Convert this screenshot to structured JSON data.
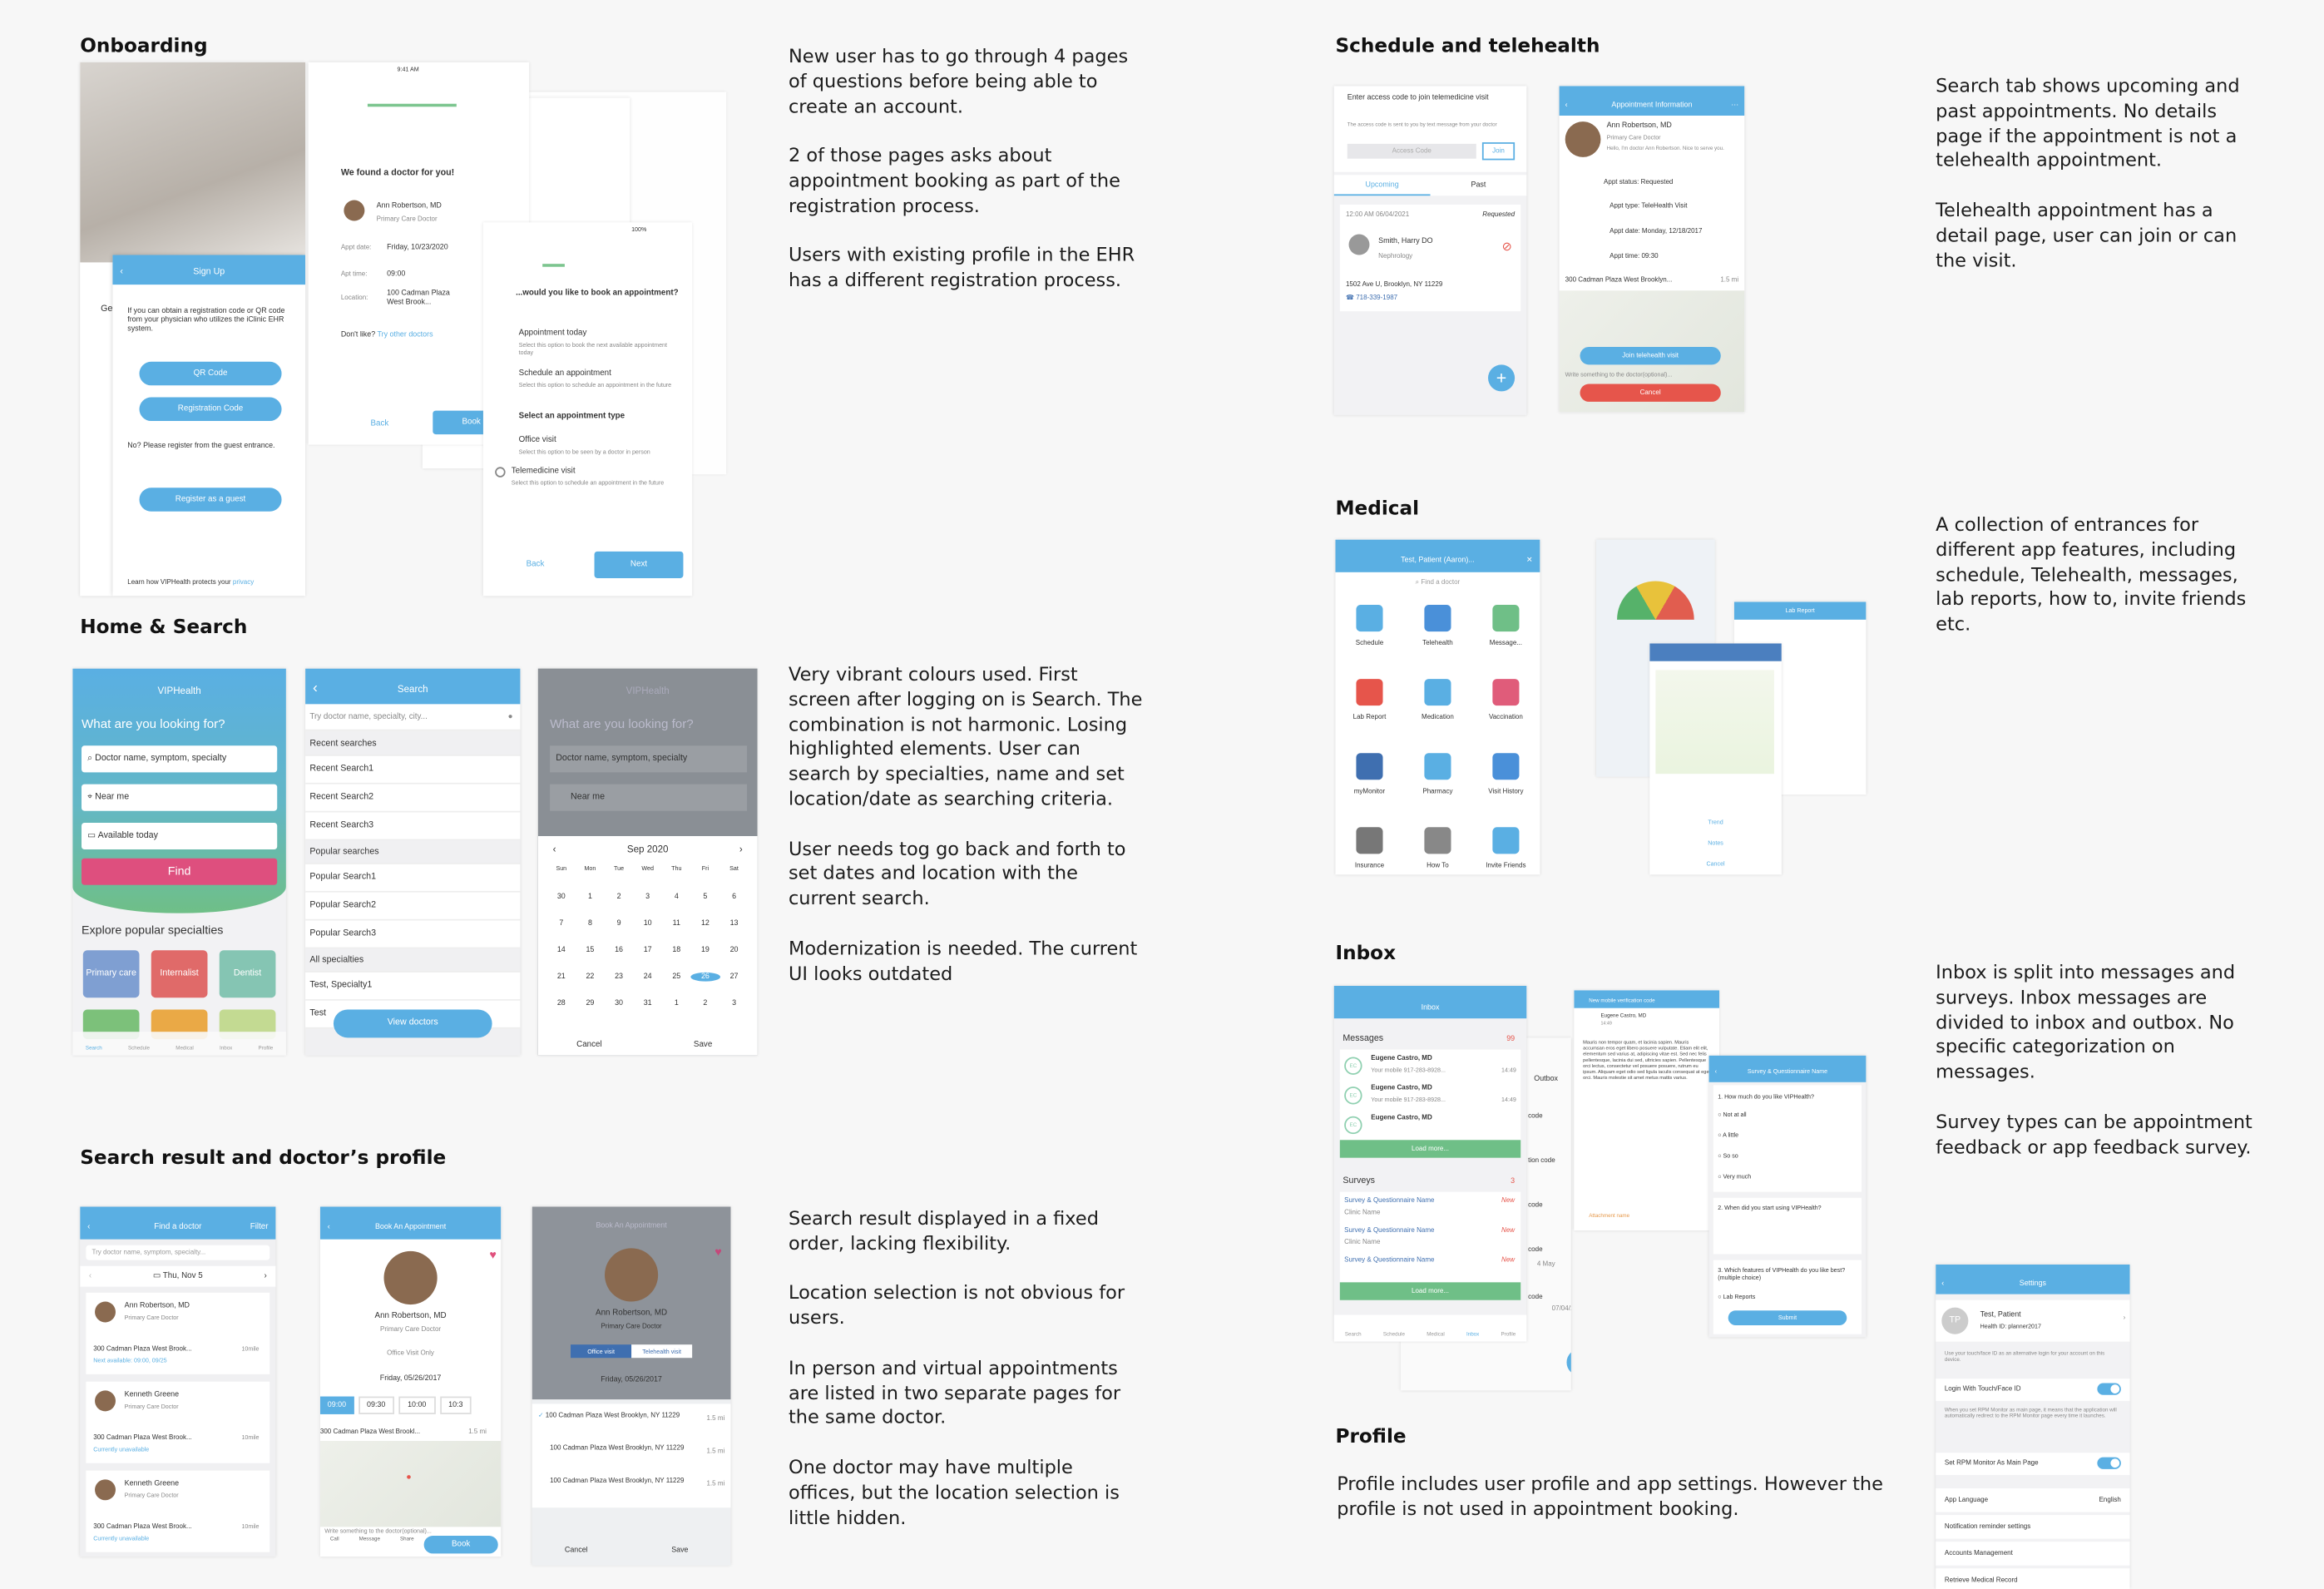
{
  "sections": {
    "onboarding": "Onboarding",
    "home": "Home & Search",
    "results": "Search result and doctor’s profile",
    "schedule": "Schedule and telehealth",
    "medical": "Medical",
    "inbox": "Inbox",
    "profile": "Profile"
  },
  "notes": {
    "onboarding": [
      "New user has to go through 4 pages of questions before being able to create an account.",
      "2 of those pages asks about appointment booking as part of the registration process.",
      "Users with existing profile in the EHR has a different registration process."
    ],
    "home": [
      "Very vibrant colours used. First screen after logging on is Search. The combination is not harmonic. Losing highlighted elements. User can search by specialties, name and set location/date as searching criteria.",
      "User needs tog go back and forth to set dates and location with the current search.",
      "Modernization is needed. The current UI looks outdated"
    ],
    "results": [
      "Search result displayed in a fixed order, lacking flexibility.",
      "Location selection is not obvious for users.",
      "In person and virtual appointments are listed in two separate pages for the same doctor.",
      "One doctor may have multiple offices, but the location selection is little hidden."
    ],
    "schedule": [
      "Search tab shows upcoming and past appointments. No details page if the appointment is not a telehealth appointment.",
      "Telehealth appointment has a detail page, user can join or can the visit."
    ],
    "medical": [
      "A collection of entrances for different app features, including schedule, Telehealth, messages, lab reports, how to, invite friends etc."
    ],
    "inbox": [
      "Inbox is split into messages and surveys. Inbox messages are divided to inbox and outbox. No specific categorization on messages.",
      "Survey types can be appointment feedback or app feedback survey."
    ],
    "profile": [
      "Profile includes user profile and app settings. However the profile is not used in appointment booking."
    ]
  },
  "colors": {
    "primary": "#5aafe3",
    "find": "#de4f7e",
    "green": "#6fbf87"
  },
  "status": {
    "time": "9:41 AM",
    "battery": "100%"
  },
  "signup": {
    "title": "Sign Up",
    "behind": "Ge",
    "text": "If you can obtain a registration code or QR code from your physician who utilizes the iClinic EHR system.",
    "qr": "QR Code",
    "reg": "Registration Code",
    "guest_text": "No? Please register from the guest entrance.",
    "guest": "Register as a guest",
    "footer": "Learn how VIPHealth protects your",
    "privacy": "privacy"
  },
  "found": {
    "title": "We found a doctor for you!",
    "doctor": "Ann Robertson, MD",
    "role": "Primary Care Doctor",
    "date_label": "Appt date:",
    "date": "Friday, 10/23/2020",
    "time_label": "Apt time:",
    "time": "09:00",
    "loc_label": "Location:",
    "loc": "100 Cadman Plaza West Brook...",
    "dislike": "Don't like?",
    "other": "Try other doctors",
    "back": "Back",
    "book": "Book"
  },
  "apptype": {
    "q": "...would you like to book an appointment?",
    "o1": "Appointment today",
    "o1d": "Select this option to book the next available appointment today",
    "o2": "Schedule an appointment",
    "o2d": "Select this option to schedule an appointment in the future",
    "title": "Select an appointment type",
    "o3": "Office visit",
    "o3d": "Select this option to be seen by a doctor in person",
    "o4": "Telemedicine visit",
    "o4d": "Select this option to schedule an appointment in the future",
    "back": "Back",
    "next": "Next"
  },
  "home": {
    "app": "VIPHealth",
    "q": "What are you looking for?",
    "f1": "Doctor name, symptom, specialty",
    "f2": "Near me",
    "f3": "Available today",
    "find": "Find",
    "explore": "Explore popular specialties",
    "tiles": [
      "Primary care",
      "Internalist",
      "Dentist"
    ],
    "tabs": [
      "Search",
      "Schedule",
      "Medical",
      "Inbox",
      "Profile"
    ]
  },
  "search": {
    "title": "Search",
    "placeholder": "Try doctor name, specialty, city...",
    "recent": "Recent searches",
    "recent_items": [
      "Recent Search1",
      "Recent Search2",
      "Recent Search3"
    ],
    "popular": "Popular searches",
    "popular_items": [
      "Popular Search1",
      "Popular Search2",
      "Popular Search3"
    ],
    "all": "All specialties",
    "spec": [
      "Test, Specialty1",
      "Test"
    ],
    "view": "View doctors"
  },
  "calendar": {
    "month": "Sep 2020",
    "days": [
      "Sun",
      "Mon",
      "Tue",
      "Wed",
      "Thu",
      "Fri",
      "Sat"
    ],
    "dates": [
      "30",
      "1",
      "2",
      "3",
      "4",
      "5",
      "6",
      "7",
      "8",
      "9",
      "10",
      "11",
      "12",
      "13",
      "14",
      "15",
      "16",
      "17",
      "18",
      "19",
      "20",
      "21",
      "22",
      "23",
      "24",
      "25",
      "26",
      "27",
      "28",
      "29",
      "30",
      "31",
      "1",
      "2",
      "3"
    ],
    "selected": "26",
    "cancel": "Cancel",
    "save": "Save"
  },
  "results": {
    "title": "Find a doctor",
    "filter": "Filter",
    "placeholder": "Try doctor name, symptom, specialty...",
    "date": "Thu, Nov 5",
    "cards": [
      {
        "name": "Ann Robertson, MD",
        "role": "Primary Care Doctor",
        "addr": "300 Cadman Plaza West Brook...",
        "dist": "10mile",
        "avail": "Next available: 09:00, 09/25"
      },
      {
        "name": "Kenneth Greene",
        "role": "Primary Care Doctor",
        "addr": "300 Cadman Plaza West Brook...",
        "dist": "10mile",
        "avail": "Currently unavailable"
      },
      {
        "name": "Kenneth Greene",
        "role": "Primary Care Doctor",
        "addr": "300 Cadman Plaza West Brook...",
        "dist": "10mile",
        "avail": "Currently unavailable"
      }
    ]
  },
  "book": {
    "title": "Book An Appointment",
    "doctor": "Ann Robertson, MD",
    "role": "Primary Care Doctor",
    "only": "Office Visit Only",
    "date": "Friday, 05/26/2017",
    "times": [
      "09:00",
      "09:30",
      "10:00",
      "10:3"
    ],
    "addr": "300 Cadman Plaza West Brookl...",
    "dist": "1.5 mi",
    "write": "Write something to the doctor(optional)...",
    "actions": [
      "Call",
      "Message",
      "Share"
    ],
    "book": "Book"
  },
  "book2": {
    "title": "Book An Appointment",
    "tab1": "Office visit",
    "tab2": "Telehealth visit",
    "addrs": [
      "100 Cadman Plaza West Brooklyn, NY 11229",
      "100 Cadman Plaza West Brooklyn, NY 11229",
      "100 Cadman Plaza West Brooklyn, NY 11229"
    ],
    "dist": "1.5 mi",
    "cancel": "Cancel",
    "save": "Save"
  },
  "sched": {
    "enter": "Enter access code to join telemedicine visit",
    "hint": "The access code is sent to you by text message from your doctor",
    "code": "Access Code",
    "join": "Join",
    "tabs": [
      "Upcoming",
      "Past"
    ],
    "when": "12:00 AM 06/04/2021",
    "status": "Requested",
    "doctor": "Smith, Harry DO",
    "spec": "Nephrology",
    "addr": "1502 Ave U, Brooklyn, NY 11229",
    "phone": "718-339-1987"
  },
  "apptinfo": {
    "title": "Appointment Information",
    "doctor": "Ann Robertson, MD",
    "role": "Primary Care Doctor",
    "hello": "Hello, I'm doctor Ann Robertson. Nice to serve you.",
    "status": "Appt status: Requested",
    "type": "Appt type: TeleHealth Visit",
    "date": "Appt date: Monday, 12/18/2017",
    "time": "Appt time: 09:30",
    "addr": "300 Cadman Plaza West Brooklyn...",
    "dist": "1.5 mi",
    "join": "Join telehealth visit",
    "write": "Write something to the doctor(optional)...",
    "cancel": "Cancel"
  },
  "medical": {
    "title": "Test, Patient (Aaron)...",
    "find": "Find a doctor",
    "items": [
      "Schedule",
      "Telehealth",
      "Message...",
      "Lab Report",
      "Medication",
      "Vaccination",
      "myMonitor",
      "Pharmacy",
      "Visit History",
      "Insurance",
      "How To",
      "Invite Friends"
    ],
    "lab": "Lab Report",
    "trend": "Trend",
    "notes": "Notes",
    "cancel": "Cancel"
  },
  "inbox": {
    "title": "Inbox",
    "messages": "Messages",
    "mcount": "99",
    "msgs": [
      {
        "from": "Eugene Castro, MD",
        "text": "Your mobile 917-283-8928...",
        "time": "14:49"
      },
      {
        "from": "Eugene Castro, MD",
        "text": "Your mobile 917-283-8928...",
        "time": "14:49"
      },
      {
        "from": "Eugene Castro, MD",
        "text": "",
        "time": ""
      }
    ],
    "more": "Load more...",
    "surveys": "Surveys",
    "scount": "3",
    "survey_items": [
      {
        "name": "Survey & Questionnaire Name",
        "clinic": "Clinic Name",
        "tag": "New"
      },
      {
        "name": "Survey & Questionnaire Name",
        "clinic": "Clinic Name",
        "tag": "New"
      },
      {
        "name": "Survey & Questionnaire Name",
        "clinic": "",
        "tag": "New"
      }
    ],
    "outbox": "Outbox",
    "outbox_rows": [
      "code",
      "tion code",
      "code",
      "code",
      "code"
    ],
    "date1": "4 May",
    "date2": "07/04/2019"
  },
  "msgdetail": {
    "title": "New mobile verification code",
    "from": "Eugene Castro, MD",
    "time": "14:49",
    "body": "Mauris non tempor quam, et lacinia sapien. Mauris accumsan eros eget libero posuere vulputate. Etiam elit elit, elementum sed varius at, adipiscing vitae est. Sed nec felis pellentesque, lacinia dui sed, ultricies sapien. Pellentesque orci lectus, consectetur vel posuere posuere, rutrum eu ipsum. Aliquam eget odio sed ligula iaculis consequat at eget orci. Mauris molestie sit amet metus mattis varius.",
    "attach": "Attachment name"
  },
  "survey": {
    "title": "Survey & Questionnaire Name",
    "q1": "1. How much do you like VIPHealth?",
    "opts": [
      "Not at all",
      "A little",
      "So so",
      "Very much"
    ],
    "q2": "2. When did you start using VIPHealth?",
    "q3": "3. Which features of VIPHealth do you like best? (multiple choice)",
    "o3": "Lab Reports",
    "submit": "Submit"
  },
  "settings": {
    "title": "Settings",
    "initials": "TP",
    "name": "Test, Patient",
    "hid": "Health ID: planner2017",
    "touch_hint": "Use your touch/face ID as an alternative login for your account on this device.",
    "touch": "Login With Touch/Face ID",
    "touch_on": true,
    "rpm_hint": "When you set RPM Monitor as main page, it means that the application will automatically redirect to the RPM Monitor page every time it launches.",
    "rpm": "Set RPM Monitor As Main Page",
    "rpm_on": true,
    "lang": "App Language",
    "lang_val": "English",
    "rows": [
      "Notification reminder settings",
      "Accounts Management",
      "Retrieve Medical Record"
    ]
  }
}
